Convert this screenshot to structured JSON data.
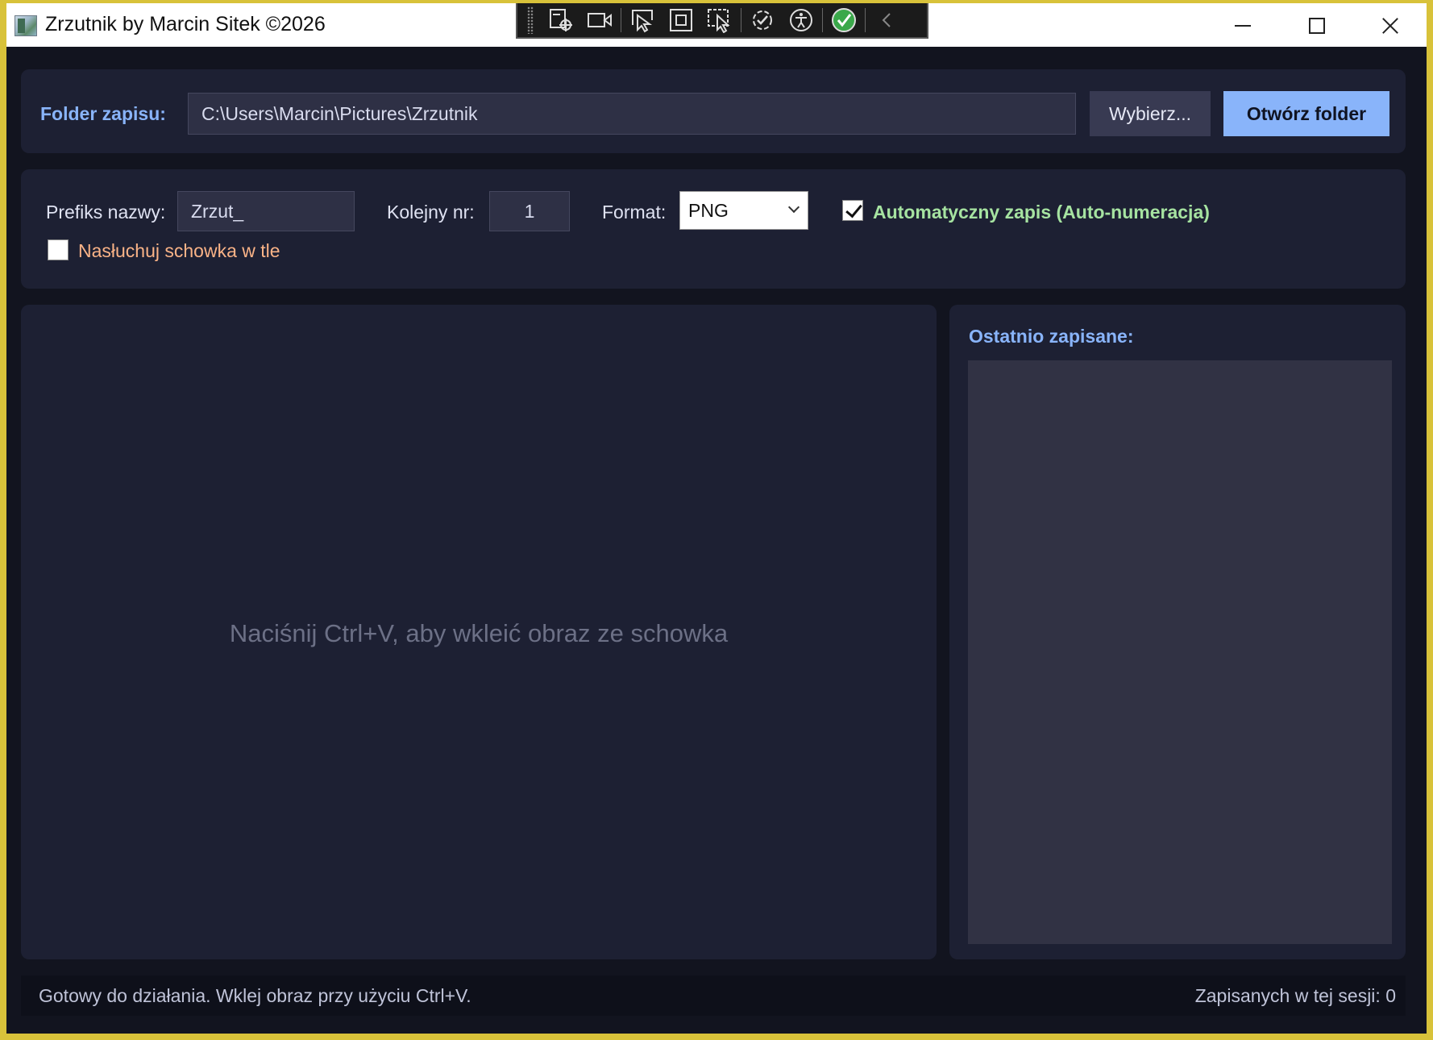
{
  "window": {
    "title": "Zrzutnik by Marcin Sitek ©2026",
    "border_color": "#d8c23a"
  },
  "devbar": {
    "tools": [
      "select-element-icon",
      "record-video-icon",
      "pick-pointer-icon",
      "track-focus-icon",
      "display-layout-icon",
      "hot-reload-icon",
      "accessibility-icon",
      "status-ok-icon",
      "collapse-chevron-icon"
    ]
  },
  "folder": {
    "label": "Folder zapisu:",
    "path": "C:\\Users\\Marcin\\Pictures\\Zrzutnik",
    "choose_label": "Wybierz...",
    "open_label": "Otwórz folder"
  },
  "options": {
    "prefix_label": "Prefiks nazwy:",
    "prefix_value": "Zrzut_",
    "counter_label": "Kolejny nr:",
    "counter_value": "1",
    "format_label": "Format:",
    "format_value": "PNG",
    "auto_save_label": "Automatyczny zapis (Auto-numeracja)",
    "auto_save_checked": true,
    "listen_label": "Nasłuchuj schowka w tle",
    "listen_checked": false
  },
  "preview": {
    "placeholder": "Naciśnij Ctrl+V, aby wkleić obraz ze schowka"
  },
  "recent": {
    "title": "Ostatnio zapisane:"
  },
  "status": {
    "message": "Gotowy do działania. Wklej obraz przy użyciu Ctrl+V.",
    "counter": "Zapisanych w tej sesji: 0"
  },
  "colors": {
    "accent_blue": "#89b4fa",
    "accent_green": "#a6e3a1",
    "accent_orange": "#fab387",
    "panel_bg": "#1d2033",
    "window_bg": "#12141f"
  }
}
